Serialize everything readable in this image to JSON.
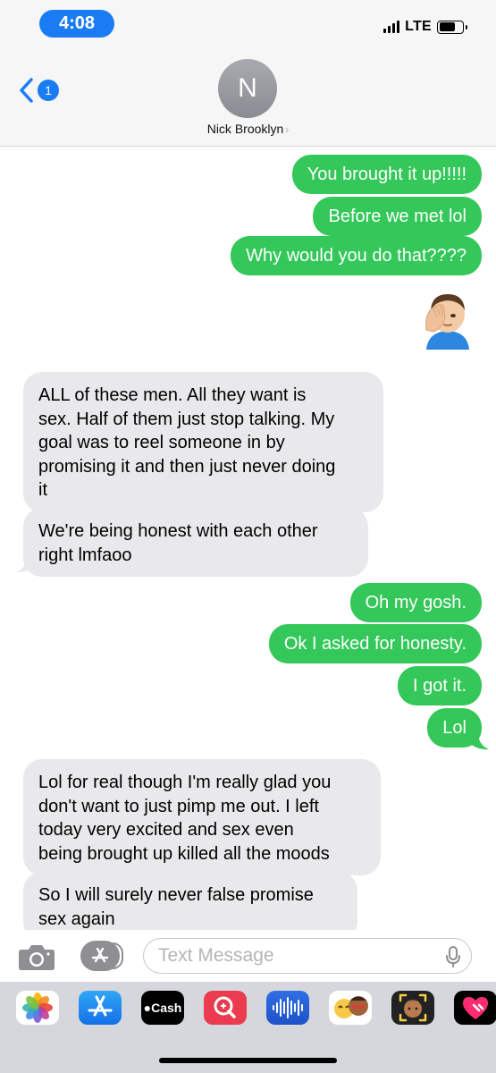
{
  "status_bar": {
    "time": "4:08",
    "network": "LTE"
  },
  "header": {
    "back_badge": "1",
    "avatar_initial": "N",
    "contact_name": "Nick Brooklyn"
  },
  "messages": [
    {
      "from": "me",
      "text": "You brought it up!!!!!"
    },
    {
      "from": "me",
      "text": "Before we met lol"
    },
    {
      "from": "me",
      "text": "Why would you do that????"
    },
    {
      "from": "me",
      "emoji": "facepalm-emoji"
    },
    {
      "from": "them",
      "lines": [
        "ALL of these men. All they want is",
        "sex. Half of them just stop talking. My",
        "goal was to reel someone in by",
        "promising it and then just never doing",
        "it"
      ]
    },
    {
      "from": "them",
      "lines": [
        "We're being honest with each other",
        "right lmfaoo"
      ]
    },
    {
      "from": "me",
      "text": "Oh my gosh."
    },
    {
      "from": "me",
      "text": "Ok I asked for honesty."
    },
    {
      "from": "me",
      "text": "I got it."
    },
    {
      "from": "me",
      "text": "Lol"
    },
    {
      "from": "them",
      "lines": [
        "Lol for real though I'm really glad you",
        "don't want to just pimp me out. I left",
        "today very excited and sex even",
        "being brought up killed all the moods"
      ]
    },
    {
      "from": "them",
      "lines": [
        "So I will surely never false promise",
        "sex again"
      ]
    }
  ],
  "compose": {
    "placeholder": "Text Message"
  },
  "app_drawer": [
    {
      "name": "photos-app-icon"
    },
    {
      "name": "app-store-icon"
    },
    {
      "name": "apple-cash-icon",
      "label": "Cash"
    },
    {
      "name": "search-images-icon"
    },
    {
      "name": "audio-message-icon"
    },
    {
      "name": "memoji-stickers-icon"
    },
    {
      "name": "animoji-icon"
    },
    {
      "name": "digital-touch-icon"
    }
  ],
  "colors": {
    "outgoing_bubble": "#34c759",
    "incoming_bubble": "#e9e9eb",
    "accent": "#1a7cf5"
  }
}
